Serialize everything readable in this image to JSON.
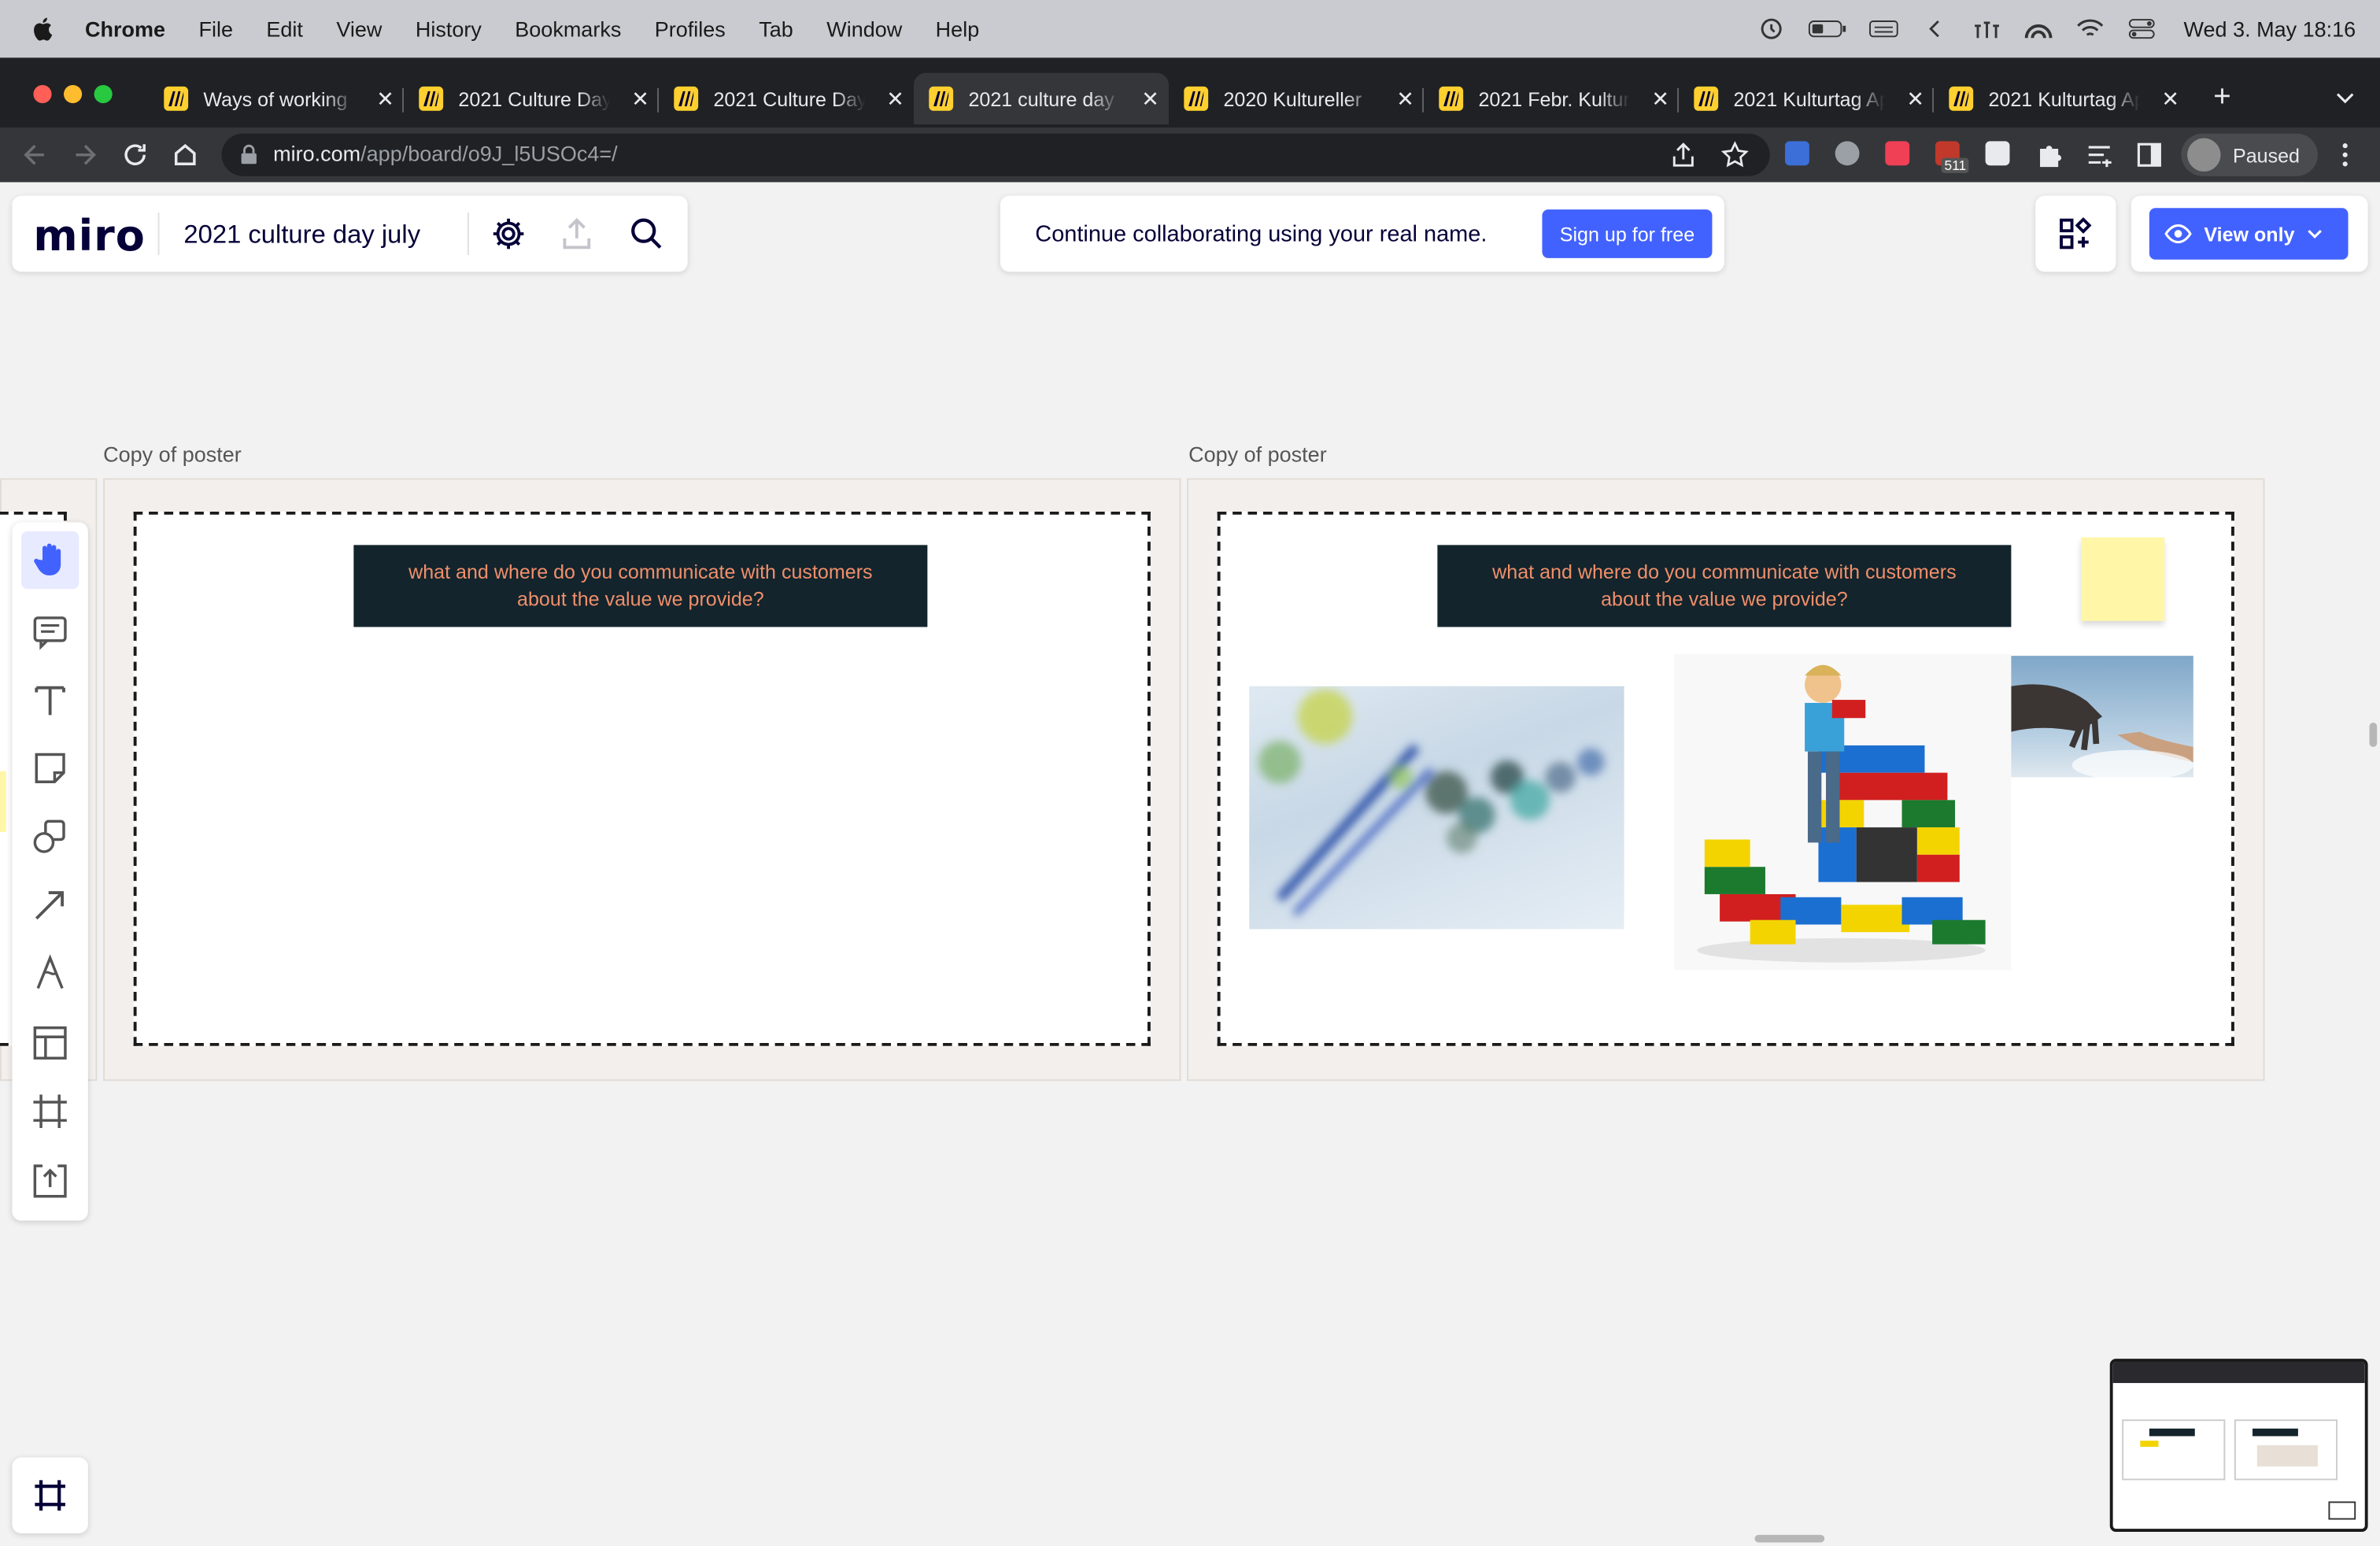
{
  "menubar": {
    "app": "Chrome",
    "items": [
      "File",
      "Edit",
      "View",
      "History",
      "Bookmarks",
      "Profiles",
      "Tab",
      "Window",
      "Help"
    ],
    "datetime": "Wed 3. May  18:16"
  },
  "browser": {
    "tabs": [
      {
        "label": "Ways of working",
        "active": false
      },
      {
        "label": "2021 Culture Day",
        "active": false
      },
      {
        "label": "2021 Culture Day",
        "active": false
      },
      {
        "label": "2021 culture day",
        "active": true
      },
      {
        "label": "2020 Kultureller",
        "active": false
      },
      {
        "label": "2021 Febr. Kultur",
        "active": false
      },
      {
        "label": "2021 Kulturtag Ap",
        "active": false
      },
      {
        "label": "2021 Kulturtag Ap",
        "active": false
      }
    ],
    "url_host": "miro.com",
    "url_path": "/app/board/o9J_l5USOc4=/",
    "profile_status": "Paused",
    "ext_badge": "511"
  },
  "miro": {
    "logo": "miro",
    "board_title": "2021 culture day july",
    "banner_text": "Continue collaborating using your real name.",
    "signup_label": "Sign up for free",
    "view_mode_label": "View only"
  },
  "canvas": {
    "frames": [
      {
        "label": "Copy of poster",
        "question": "what and where do you communicate with customers about the value we provide?"
      },
      {
        "label": "Copy of poster",
        "question": "what and where do you communicate with customers about the value we provide?"
      }
    ]
  },
  "tools": [
    "hand-icon",
    "comment-icon",
    "text-icon",
    "sticky-note-icon",
    "shapes-icon",
    "arrow-icon",
    "pen-icon",
    "templates-icon",
    "frame-icon",
    "upload-icon"
  ],
  "colors": {
    "accent": "#4262ff",
    "question_bg": "#13242c",
    "question_text": "#f08f6b",
    "sticky": "#fff6a7"
  }
}
